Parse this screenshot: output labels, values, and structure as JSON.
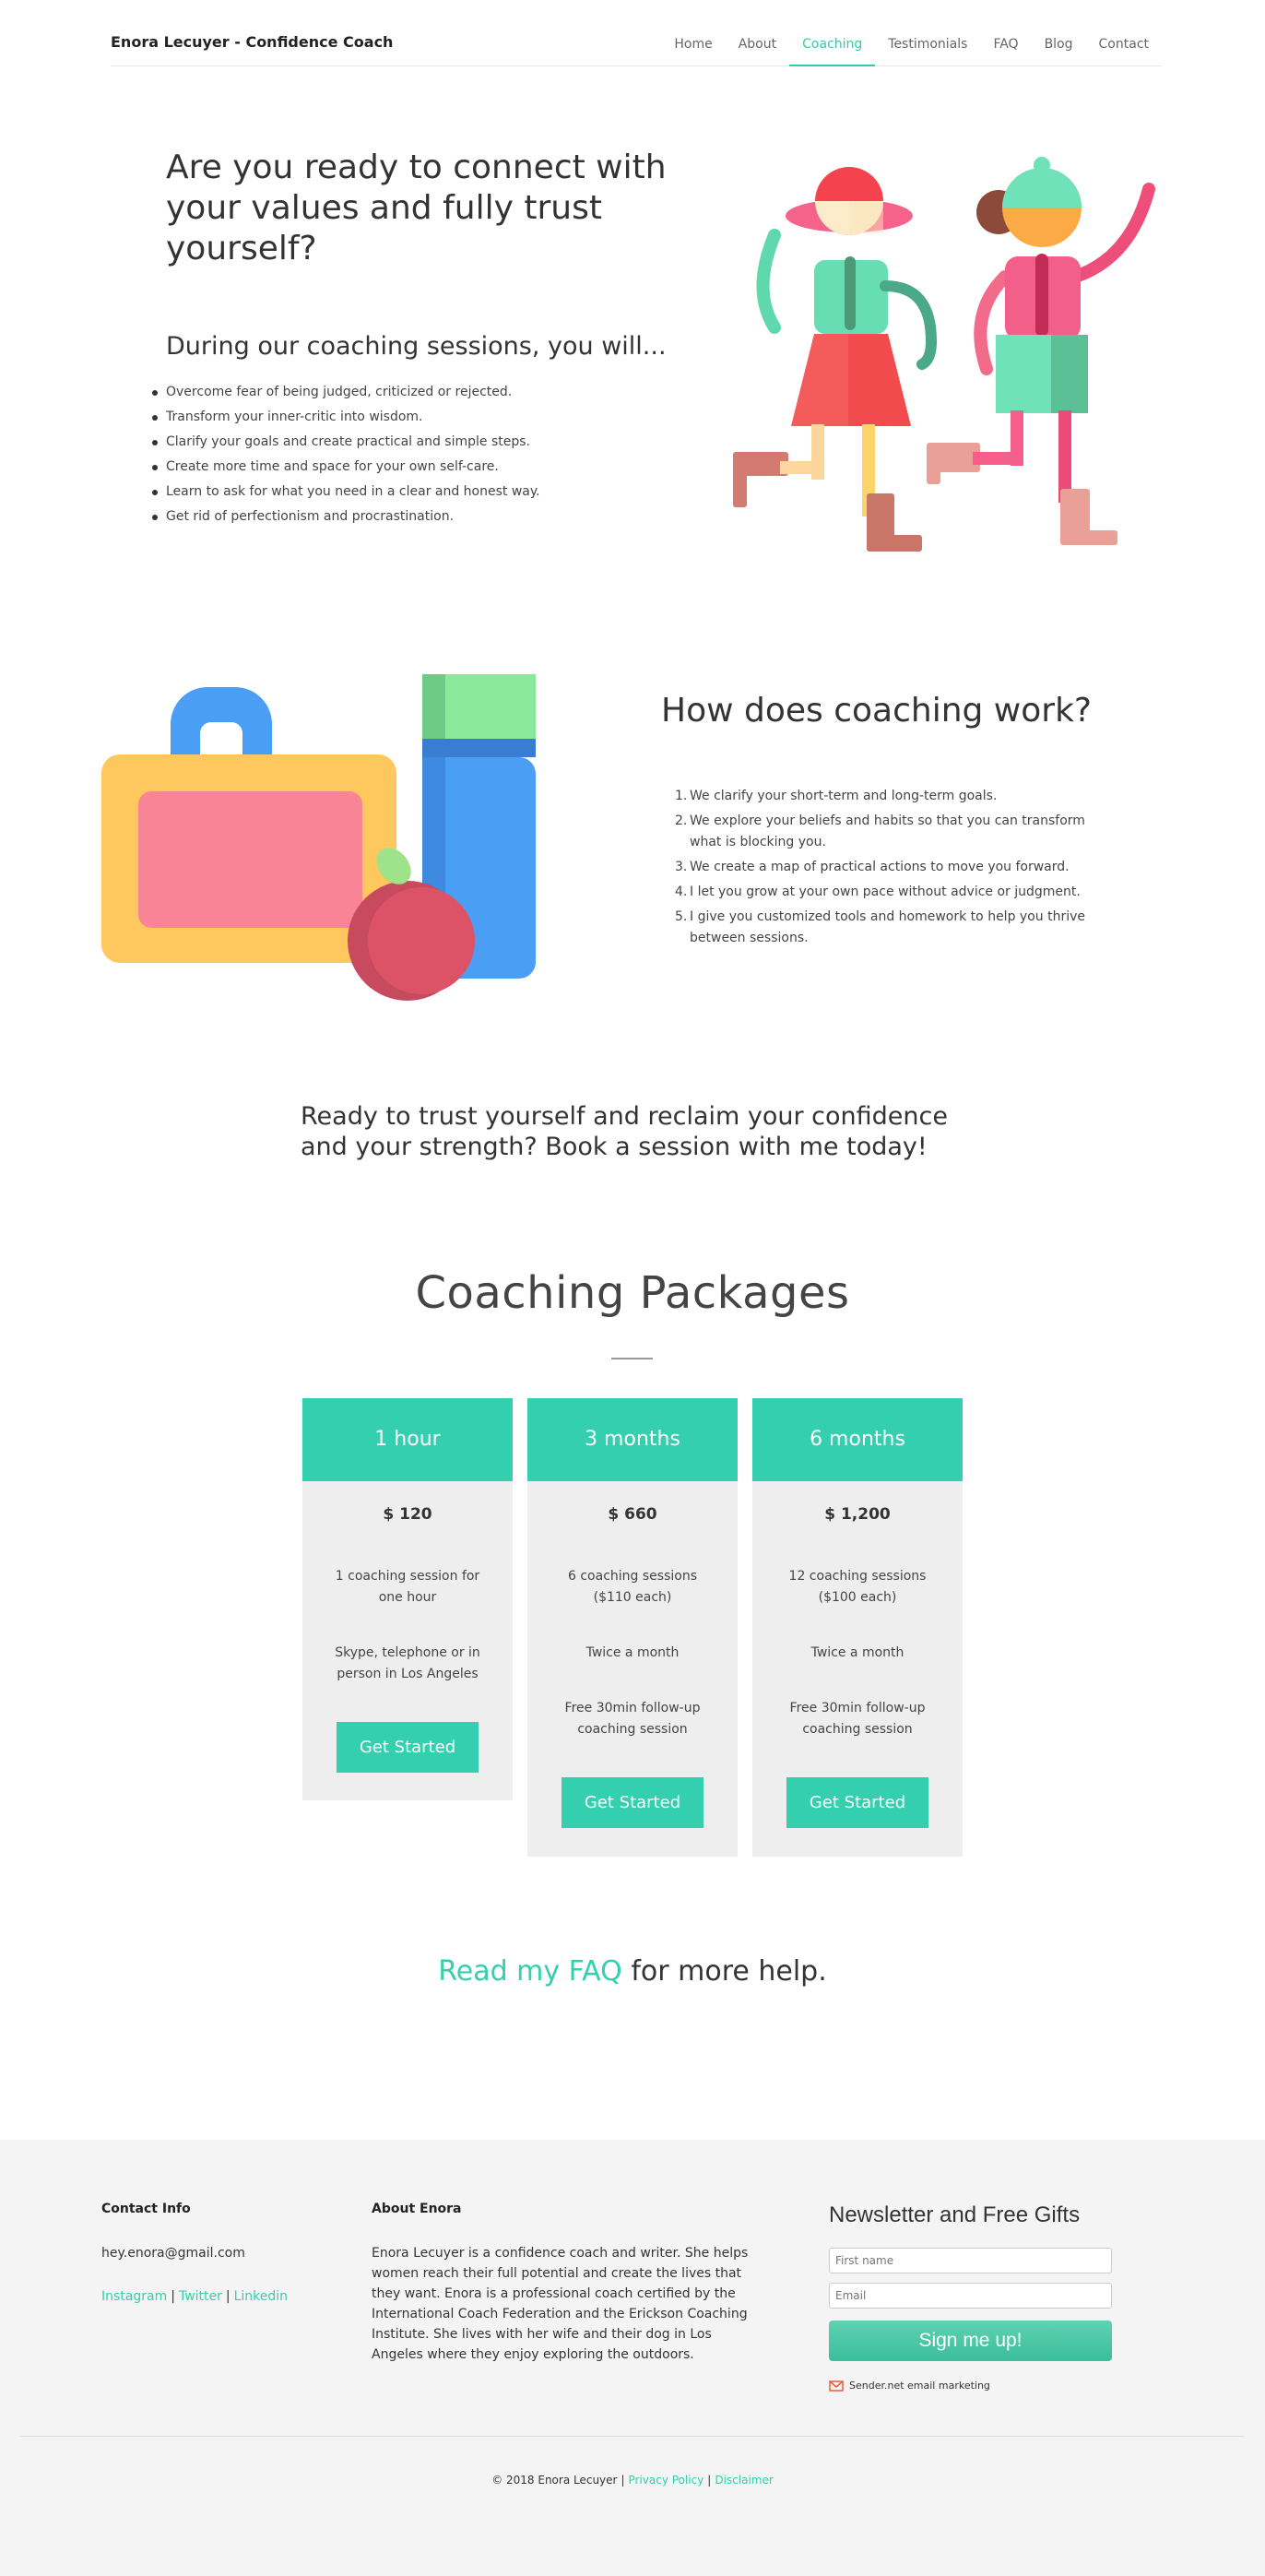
{
  "header": {
    "brand": "Enora Lecuyer - Confidence Coach",
    "nav": [
      "Home",
      "About",
      "Coaching",
      "Testimonials",
      "FAQ",
      "Blog",
      "Contact"
    ],
    "active_nav": "Coaching"
  },
  "hero": {
    "title": "Are you ready to connect with your values and fully trust yourself?",
    "subtitle": "During our coaching sessions, you will...",
    "items": [
      "Overcome fear of being judged, criticized or rejected.",
      "Transform your inner-critic into wisdom.",
      "Clarify your goals and create practical and simple steps.",
      "Create more time and space for your own self-care.",
      "Learn to ask for what you need in a clear and honest way.",
      "Get rid of perfectionism and procrastination."
    ]
  },
  "how": {
    "title": "How does coaching work?",
    "steps": [
      "We clarify your short-term and long-term goals.",
      "We explore your beliefs and habits so that you can transform what is blocking you.",
      "We create a map of practical actions to move you forward.",
      "I let you grow at your own pace without advice or judgment.",
      "I give you customized tools and homework to help you thrive between sessions."
    ]
  },
  "ready": "Ready to trust yourself and reclaim your confidence and your strength? Book a session with me today!",
  "packages": {
    "title": "Coaching Packages",
    "items": [
      {
        "name": "1 hour",
        "price": "$ 120",
        "lines": [
          "1 coaching session for one hour",
          "Skype, telephone or in person in Los Angeles"
        ],
        "button": "Get Started"
      },
      {
        "name": "3 months",
        "price": "$ 660",
        "lines": [
          "6 coaching sessions ($110 each)",
          "Twice a month",
          "Free 30min follow-up coaching session"
        ],
        "button": "Get Started"
      },
      {
        "name": "6 months",
        "price": "$ 1,200",
        "lines": [
          "12 coaching sessions ($100 each)",
          "Twice a month",
          "Free 30min follow-up coaching session"
        ],
        "button": "Get Started"
      }
    ]
  },
  "faq": {
    "link": "Read my FAQ",
    "rest": " for more help."
  },
  "footer": {
    "contact_head": "Contact Info",
    "email": "hey.enora@gmail.com",
    "social": [
      "Instagram",
      "Twitter",
      "Linkedin"
    ],
    "sep": "|",
    "about_head": "About Enora",
    "about_text": "Enora Lecuyer is a confidence coach and writer. She helps women reach their full potential and create the lives that they want. Enora is a professional coach certified by the International Coach Federation and the Erickson Coaching Institute. She lives with her wife and their dog in Los Angeles where they enjoy exploring the outdoors.",
    "newsletter_title": "Newsletter and Free Gifts",
    "first_name_placeholder": "First name",
    "email_placeholder": "Email",
    "signup_button": "Sign me up!",
    "sender": "Sender.net email marketing",
    "copyright": "© 2018 Enora Lecuyer",
    "privacy": "Privacy Policy",
    "disclaimer": "Disclaimer"
  },
  "colors": {
    "accent": "#33cfae",
    "footer_bg": "#f4f4f4",
    "card_bg": "#eeeeee"
  }
}
